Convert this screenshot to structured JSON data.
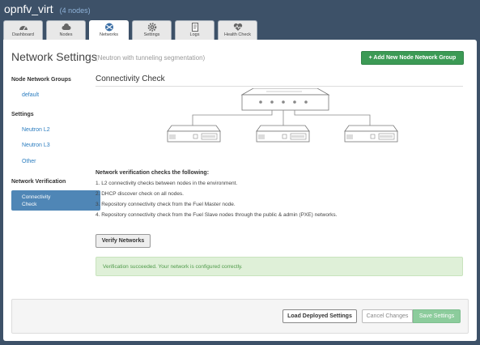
{
  "header": {
    "env_name": "opnfv_virt",
    "node_count": "(4 nodes)"
  },
  "tabs": [
    {
      "label": "Dashboard",
      "icon": "dashboard-icon"
    },
    {
      "label": "Nodes",
      "icon": "cloud-icon"
    },
    {
      "label": "Networks",
      "icon": "network-icon",
      "active": true
    },
    {
      "label": "Settings",
      "icon": "gear-icon"
    },
    {
      "label": "Logs",
      "icon": "logs-icon"
    },
    {
      "label": "Health Check",
      "icon": "heart-icon"
    }
  ],
  "page": {
    "title": "Network Settings",
    "subtitle": "(Neutron with tunneling segmentation)",
    "add_button": "+ Add New Node Network Group"
  },
  "sidebar": {
    "groups_heading": "Node Network Groups",
    "groups": [
      "default"
    ],
    "settings_heading": "Settings",
    "settings": [
      "Neutron L2",
      "Neutron L3",
      "Other"
    ],
    "verification_heading": "Network Verification",
    "active_item_line1": "Connectivity",
    "active_item_line2": "Check"
  },
  "main": {
    "section_title": "Connectivity Check",
    "checks_title": "Network verification checks the following:",
    "checks": [
      "1. L2 connectivity checks between nodes in the environment.",
      "2. DHCP discover check on all nodes.",
      "3. Repository connectivity check from the Fuel Master node.",
      "4. Repository connectivity check from the Fuel Slave nodes through the public & admin (PXE) networks."
    ],
    "verify_button": "Verify Networks",
    "alert": "Verification succeeded. Your network is configured correctly."
  },
  "footer": {
    "load_button": "Load Deployed Settings",
    "cancel_button": "Cancel Changes",
    "save_button": "Save Settings"
  },
  "colors": {
    "header_bg": "#3d5168",
    "primary_green": "#3c9a55",
    "link_blue": "#2a7cbf",
    "active_nav": "#4f86b6",
    "success_bg": "#dff0d8"
  }
}
